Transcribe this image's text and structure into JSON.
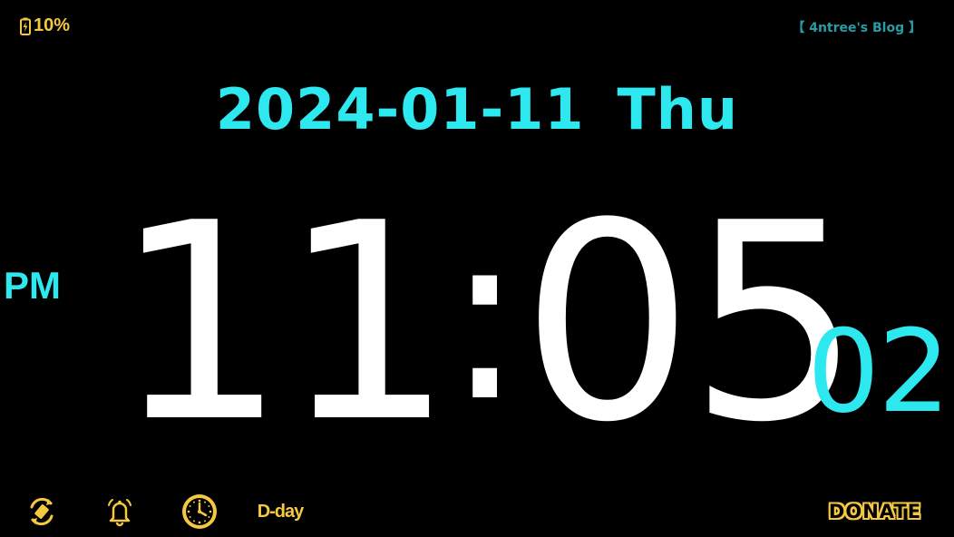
{
  "status": {
    "battery_icon": "battery-charging-icon",
    "battery_percent": "10%"
  },
  "header": {
    "blog_link": "【 4ntree's Blog 】"
  },
  "clock": {
    "date": "2024-01-11",
    "weekday": "Thu",
    "ampm": "PM",
    "hours": "11",
    "separator": ":",
    "minutes": "05",
    "seconds": "02"
  },
  "toolbar": {
    "rotate_icon": "screen-rotate-icon",
    "alarm_icon": "alarm-bell-icon",
    "clock_icon": "clock-icon",
    "dday_label": "D-day",
    "donate_label": "DONATE"
  },
  "colors": {
    "background": "#000000",
    "accent_cyan": "#2ee8f0",
    "accent_yellow": "#f5c842",
    "time_white": "#ffffff",
    "link_teal": "#2a9ca6"
  }
}
